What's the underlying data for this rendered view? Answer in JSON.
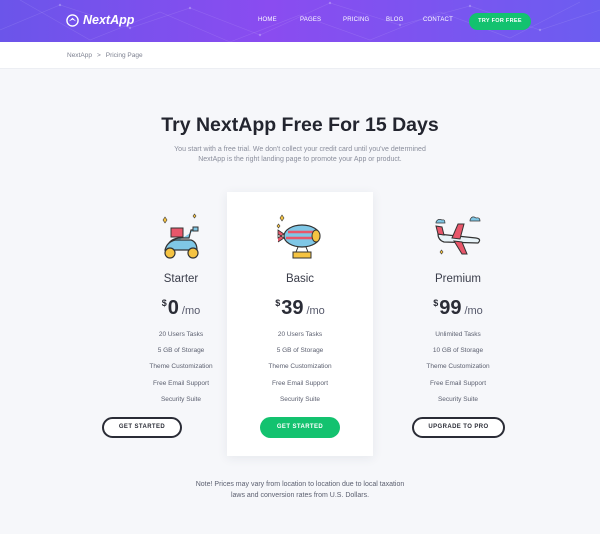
{
  "header": {
    "logo_text": "NextApp",
    "logo_icon": "nextapp-logo-icon",
    "nav": [
      "HOME",
      "PAGES",
      "PRICING",
      "BLOG",
      "CONTACT"
    ],
    "cta_label": "TRY FOR FREE",
    "colors": {
      "gradient_start": "#6b55ea",
      "gradient_end": "#8a4cf0",
      "cta": "#13c26f"
    }
  },
  "breadcrumb": {
    "items": [
      "NextApp",
      "Pricing Page"
    ],
    "separator": ">"
  },
  "hero": {
    "title": "Try NextApp Free For 15 Days",
    "subtitle": "You start with a free trial. We don't collect your credit card until you've determined NextApp is the right landing page to promote your App or product."
  },
  "plans": [
    {
      "name": "Starter",
      "currency": "$",
      "price": "0",
      "period": "/mo",
      "icon": "scooter-icon",
      "features": [
        "20 Users Tasks",
        "5 GB of Storage",
        "Theme Customization",
        "Free Email Support",
        "Security Suite"
      ],
      "button": "GET STARTED",
      "highlighted": false
    },
    {
      "name": "Basic",
      "currency": "$",
      "price": "39",
      "period": "/mo",
      "icon": "airship-icon",
      "features": [
        "20 Users Tasks",
        "5 GB of Storage",
        "Theme Customization",
        "Free Email Support",
        "Security Suite"
      ],
      "button": "GET STARTED",
      "highlighted": true
    },
    {
      "name": "Premium",
      "currency": "$",
      "price": "99",
      "period": "/mo",
      "icon": "airplane-icon",
      "features": [
        "Unlimited Tasks",
        "10 GB of Storage",
        "Theme Customization",
        "Free Email Support",
        "Security Suite"
      ],
      "button": "UPGRADE TO PRO",
      "highlighted": false
    }
  ],
  "note": "Note! Prices may vary from location to location due to local taxation laws and conversion rates from U.S. Dollars."
}
